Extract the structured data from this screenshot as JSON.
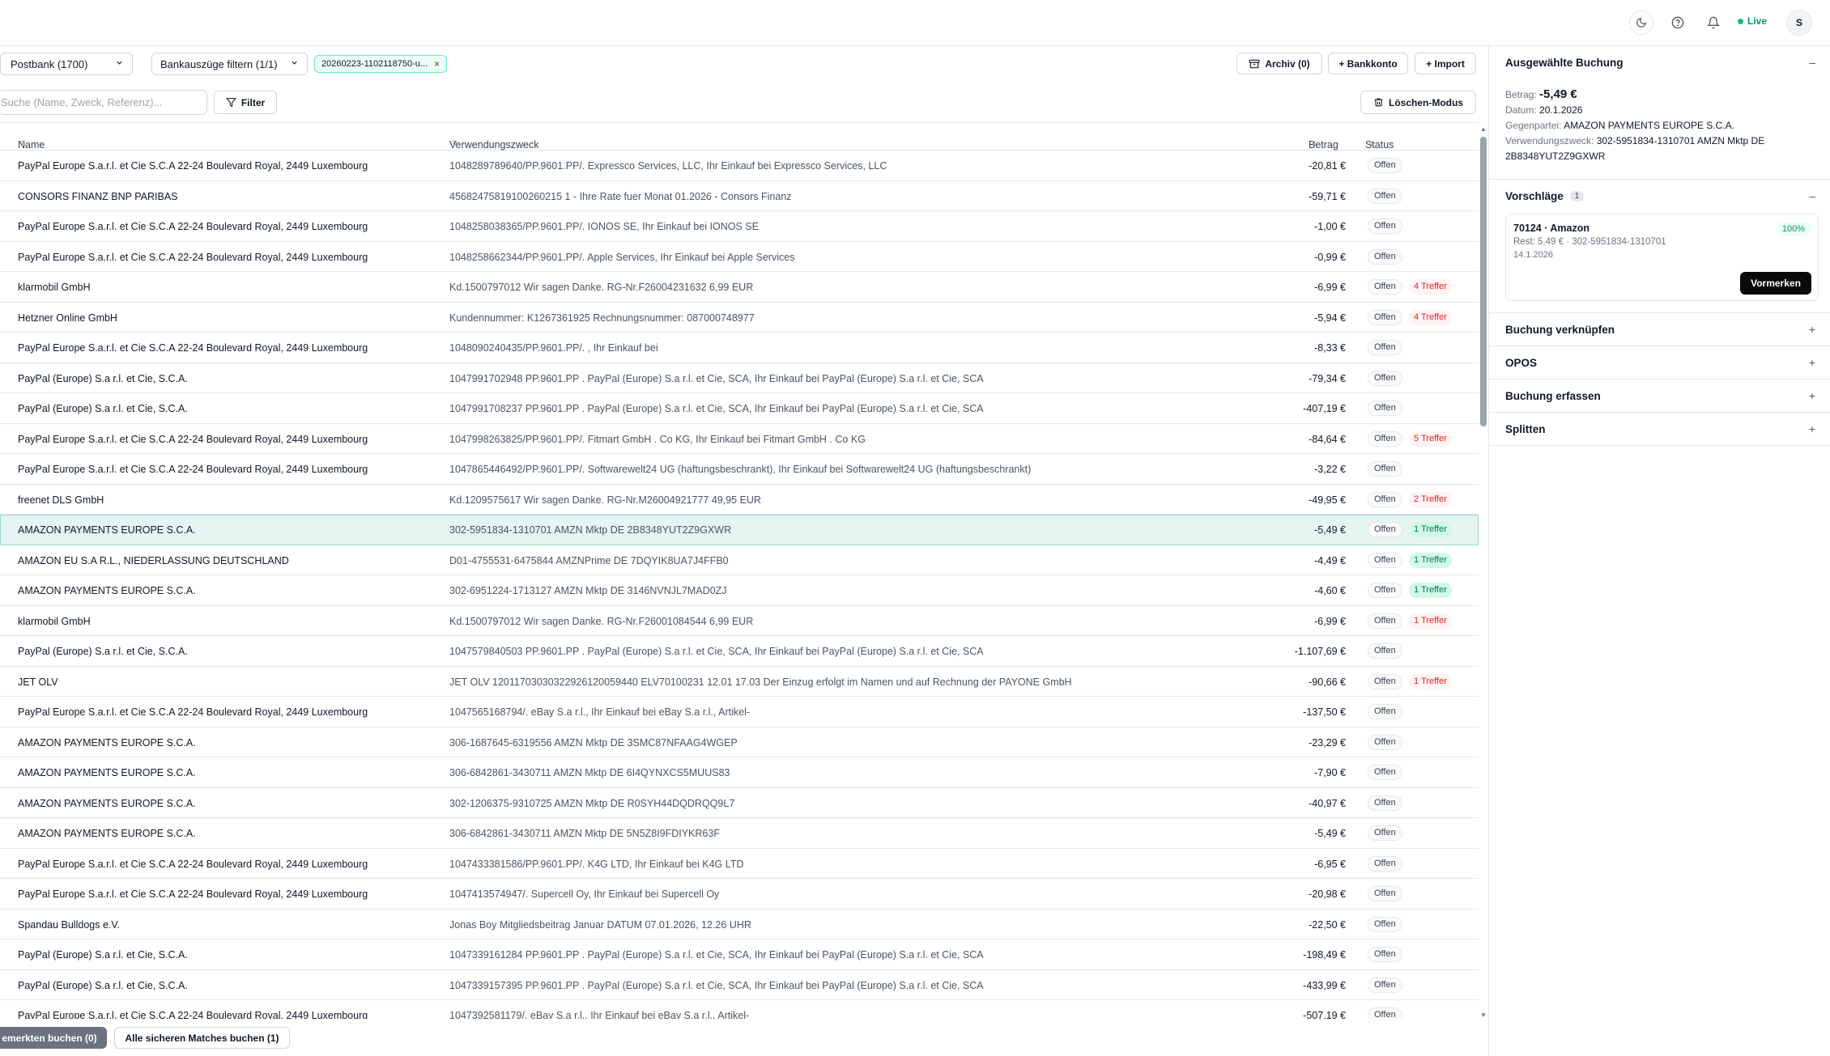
{
  "topbar": {
    "live_label": "Live",
    "avatar_initial": "S",
    "icons": [
      "moon-icon",
      "help-icon",
      "bell-icon"
    ]
  },
  "toolbar": {
    "bank_select": "Postbank (1700)",
    "statement_filter": "Bankauszüge filtern (1/1)",
    "statement_chip": "20260223-1102118750-u...",
    "archive_label": "Archiv (0)",
    "add_bank_label": "+ Bankkonto",
    "import_label": "+ Import",
    "search_placeholder": "Suche (Name, Zweck, Referenz)...",
    "filter_label": "Filter",
    "delete_mode_label": "Löschen-Modus"
  },
  "table": {
    "columns": {
      "name": "Name",
      "zweck": "Verwendungszweck",
      "betrag": "Betrag",
      "status": "Status"
    },
    "rows": [
      {
        "name": "PayPal Europe S.a.r.l. et Cie S.C.A 22-24 Boulevard Royal, 2449 Luxembourg",
        "zweck": "1048289789640/PP.9601.PP/. Expressco Services, LLC, Ihr Einkauf bei Expressco Services, LLC",
        "betrag": "-20,81 €",
        "status": "Offen",
        "badge": "",
        "badge_type": ""
      },
      {
        "name": "CONSORS FINANZ BNP PARIBAS",
        "zweck": "45682475819100260215 1 - Ihre Rate fuer Monat 01.2026 - Consors Finanz",
        "betrag": "-59,71 €",
        "status": "Offen",
        "badge": "",
        "badge_type": ""
      },
      {
        "name": "PayPal Europe S.a.r.l. et Cie S.C.A 22-24 Boulevard Royal, 2449 Luxembourg",
        "zweck": "1048258038365/PP.9601.PP/. IONOS SE, Ihr Einkauf bei IONOS SE",
        "betrag": "-1,00 €",
        "status": "Offen",
        "badge": "",
        "badge_type": ""
      },
      {
        "name": "PayPal Europe S.a.r.l. et Cie S.C.A 22-24 Boulevard Royal, 2449 Luxembourg",
        "zweck": "1048258662344/PP.9601.PP/. Apple Services, Ihr Einkauf bei Apple Services",
        "betrag": "-0,99 €",
        "status": "Offen",
        "badge": "",
        "badge_type": ""
      },
      {
        "name": "klarmobil GmbH",
        "zweck": "Kd.1500797012 Wir sagen Danke. RG-Nr.F26004231632 6,99 EUR",
        "betrag": "-6,99 €",
        "status": "Offen",
        "badge": "4 Treffer",
        "badge_type": "red"
      },
      {
        "name": "Hetzner Online GmbH",
        "zweck": "Kundennummer: K1267361925 Rechnungsnummer: 087000748977",
        "betrag": "-5,94 €",
        "status": "Offen",
        "badge": "4 Treffer",
        "badge_type": "red"
      },
      {
        "name": "PayPal Europe S.a.r.l. et Cie S.C.A 22-24 Boulevard Royal, 2449 Luxembourg",
        "zweck": "1048090240435/PP.9601.PP/. , Ihr Einkauf bei",
        "betrag": "-8,33 €",
        "status": "Offen",
        "badge": "",
        "badge_type": ""
      },
      {
        "name": "PayPal (Europe) S.a r.l. et Cie, S.C.A.",
        "zweck": "1047991702948 PP.9601.PP . PayPal (Europe) S.a r.l. et Cie, SCA, Ihr Einkauf bei PayPal (Europe) S.a r.l. et Cie, SCA",
        "betrag": "-79,34 €",
        "status": "Offen",
        "badge": "",
        "badge_type": ""
      },
      {
        "name": "PayPal (Europe) S.a r.l. et Cie, S.C.A.",
        "zweck": "1047991708237 PP.9601.PP . PayPal (Europe) S.a r.l. et Cie, SCA, Ihr Einkauf bei PayPal (Europe) S.a r.l. et Cie, SCA",
        "betrag": "-407,19 €",
        "status": "Offen",
        "badge": "",
        "badge_type": ""
      },
      {
        "name": "PayPal Europe S.a.r.l. et Cie S.C.A 22-24 Boulevard Royal, 2449 Luxembourg",
        "zweck": "1047998263825/PP.9601.PP/. Fitmart GmbH . Co KG, Ihr Einkauf bei Fitmart GmbH . Co KG",
        "betrag": "-84,64 €",
        "status": "Offen",
        "badge": "5 Treffer",
        "badge_type": "red"
      },
      {
        "name": "PayPal Europe S.a.r.l. et Cie S.C.A 22-24 Boulevard Royal, 2449 Luxembourg",
        "zweck": "1047865446492/PP.9601.PP/. Softwarewelt24 UG (haftungsbeschrankt), Ihr Einkauf bei Softwarewelt24 UG (haftungsbeschrankt)",
        "betrag": "-3,22 €",
        "status": "Offen",
        "badge": "",
        "badge_type": ""
      },
      {
        "name": "freenet DLS GmbH",
        "zweck": "Kd.1209575617 Wir sagen Danke. RG-Nr.M26004921777 49,95 EUR",
        "betrag": "-49,95 €",
        "status": "Offen",
        "badge": "2 Treffer",
        "badge_type": "red"
      },
      {
        "name": "AMAZON PAYMENTS EUROPE S.C.A.",
        "zweck": "302-5951834-1310701 AMZN Mktp DE 2B8348YUT2Z9GXWR",
        "betrag": "-5,49 €",
        "status": "Offen",
        "badge": "1 Treffer",
        "badge_type": "green",
        "selected": true
      },
      {
        "name": "AMAZON EU S.A R.L., NIEDERLASSUNG DEUTSCHLAND",
        "zweck": "D01-4755531-6475844 AMZNPrime DE 7DQYIK8UA7J4FFB0",
        "betrag": "-4,49 €",
        "status": "Offen",
        "badge": "1 Treffer",
        "badge_type": "green"
      },
      {
        "name": "AMAZON PAYMENTS EUROPE S.C.A.",
        "zweck": "302-6951224-1713127 AMZN Mktp DE 3146NVNJL7MAD0ZJ",
        "betrag": "-4,60 €",
        "status": "Offen",
        "badge": "1 Treffer",
        "badge_type": "green"
      },
      {
        "name": "klarmobil GmbH",
        "zweck": "Kd.1500797012 Wir sagen Danke. RG-Nr.F26001084544 6,99 EUR",
        "betrag": "-6,99 €",
        "status": "Offen",
        "badge": "1 Treffer",
        "badge_type": "red"
      },
      {
        "name": "PayPal (Europe) S.a r.l. et Cie, S.C.A.",
        "zweck": "1047579840503 PP.9601.PP . PayPal (Europe) S.a r.l. et Cie, SCA, Ihr Einkauf bei PayPal (Europe) S.a r.l. et Cie, SCA",
        "betrag": "-1.107,69 €",
        "status": "Offen",
        "badge": "",
        "badge_type": ""
      },
      {
        "name": "JET OLV",
        "zweck": "JET OLV 12011703030322926120059440 ELV70100231 12.01 17.03 Der Einzug erfolgt im Namen und auf Rechnung der PAYONE GmbH",
        "betrag": "-90,66 €",
        "status": "Offen",
        "badge": "1 Treffer",
        "badge_type": "red"
      },
      {
        "name": "PayPal Europe S.a.r.l. et Cie S.C.A 22-24 Boulevard Royal, 2449 Luxembourg",
        "zweck": "1047565168794/. eBay S.a r.l., Ihr Einkauf bei eBay S.a r.l., Artikel-",
        "betrag": "-137,50 €",
        "status": "Offen",
        "badge": "",
        "badge_type": ""
      },
      {
        "name": "AMAZON PAYMENTS EUROPE S.C.A.",
        "zweck": "306-1687645-6319556 AMZN Mktp DE 3SMC87NFAAG4WGEP",
        "betrag": "-23,29 €",
        "status": "Offen",
        "badge": "",
        "badge_type": ""
      },
      {
        "name": "AMAZON PAYMENTS EUROPE S.C.A.",
        "zweck": "306-6842861-3430711 AMZN Mktp DE 6I4QYNXCS5MUUS83",
        "betrag": "-7,90 €",
        "status": "Offen",
        "badge": "",
        "badge_type": ""
      },
      {
        "name": "AMAZON PAYMENTS EUROPE S.C.A.",
        "zweck": "302-1206375-9310725 AMZN Mktp DE R0SYH44DQDRQQ9L7",
        "betrag": "-40,97 €",
        "status": "Offen",
        "badge": "",
        "badge_type": ""
      },
      {
        "name": "AMAZON PAYMENTS EUROPE S.C.A.",
        "zweck": "306-6842861-3430711 AMZN Mktp DE 5N5Z8I9FDIYKR63F",
        "betrag": "-5,49 €",
        "status": "Offen",
        "badge": "",
        "badge_type": ""
      },
      {
        "name": "PayPal Europe S.a.r.l. et Cie S.C.A 22-24 Boulevard Royal, 2449 Luxembourg",
        "zweck": "1047433381586/PP.9601.PP/. K4G LTD, Ihr Einkauf bei K4G LTD",
        "betrag": "-6,95 €",
        "status": "Offen",
        "badge": "",
        "badge_type": ""
      },
      {
        "name": "PayPal Europe S.a.r.l. et Cie S.C.A 22-24 Boulevard Royal, 2449 Luxembourg",
        "zweck": "1047413574947/. Supercell Oy, Ihr Einkauf bei Supercell Oy",
        "betrag": "-20,98 €",
        "status": "Offen",
        "badge": "",
        "badge_type": ""
      },
      {
        "name": "Spandau Bulldogs e.V.",
        "zweck": "Jonas Boy Mitgliedsbeitrag Januar DATUM 07.01.2026, 12.26 UHR",
        "betrag": "-22,50 €",
        "status": "Offen",
        "badge": "",
        "badge_type": ""
      },
      {
        "name": "PayPal (Europe) S.a r.l. et Cie, S.C.A.",
        "zweck": "1047339161284 PP.9601.PP . PayPal (Europe) S.a r.l. et Cie, SCA, Ihr Einkauf bei PayPal (Europe) S.a r.l. et Cie, SCA",
        "betrag": "-198,49 €",
        "status": "Offen",
        "badge": "",
        "badge_type": ""
      },
      {
        "name": "PayPal (Europe) S.a r.l. et Cie, S.C.A.",
        "zweck": "1047339157395 PP.9601.PP . PayPal (Europe) S.a r.l. et Cie, SCA, Ihr Einkauf bei PayPal (Europe) S.a r.l. et Cie, SCA",
        "betrag": "-433,99 €",
        "status": "Offen",
        "badge": "",
        "badge_type": ""
      },
      {
        "name": "PayPal Europe S.a.r.l. et Cie S.C.A 22-24 Boulevard Royal, 2449 Luxembourg",
        "zweck": "1047392581179/. eBay S.a r.l., Ihr Einkauf bei eBay S.a r.l., Artikel-",
        "betrag": "-507,19 €",
        "status": "Offen",
        "badge": "",
        "badge_type": ""
      }
    ]
  },
  "bottombar": {
    "vormerken_label": "emerkten buchen (0)",
    "alle_label": "Alle sicheren Matches buchen (1)"
  },
  "side": {
    "selected": {
      "title": "Ausgewählte Buchung",
      "betrag_label": "Betrag:",
      "betrag_value": "-5,49 €",
      "datum_label": "Datum:",
      "datum_value": "20.1.2026",
      "gegenpartei_label": "Gegenpartei:",
      "gegenpartei_value": "AMAZON PAYMENTS EUROPE S.C.A.",
      "zweck_label": "Verwendungszweck:",
      "zweck_value": "302-5951834-1310701 AMZN Mktp DE 2B8348YUT2Z9GXWR"
    },
    "suggestions": {
      "title": "Vorschläge",
      "count": "1",
      "card_title": "70124 · Amazon",
      "card_sub": "Rest: 5,49 € · 302-5951834-1310701",
      "card_date": "14.1.2026",
      "card_pct": "100%",
      "card_button": "Vormerken"
    },
    "sections": [
      {
        "title": "Buchung verknüpfen",
        "toggle": "+"
      },
      {
        "title": "OPOS",
        "toggle": "+"
      },
      {
        "title": "Buchung erfassen",
        "toggle": "+"
      },
      {
        "title": "Splitten",
        "toggle": "+"
      }
    ],
    "collapse_toggle": "–"
  }
}
